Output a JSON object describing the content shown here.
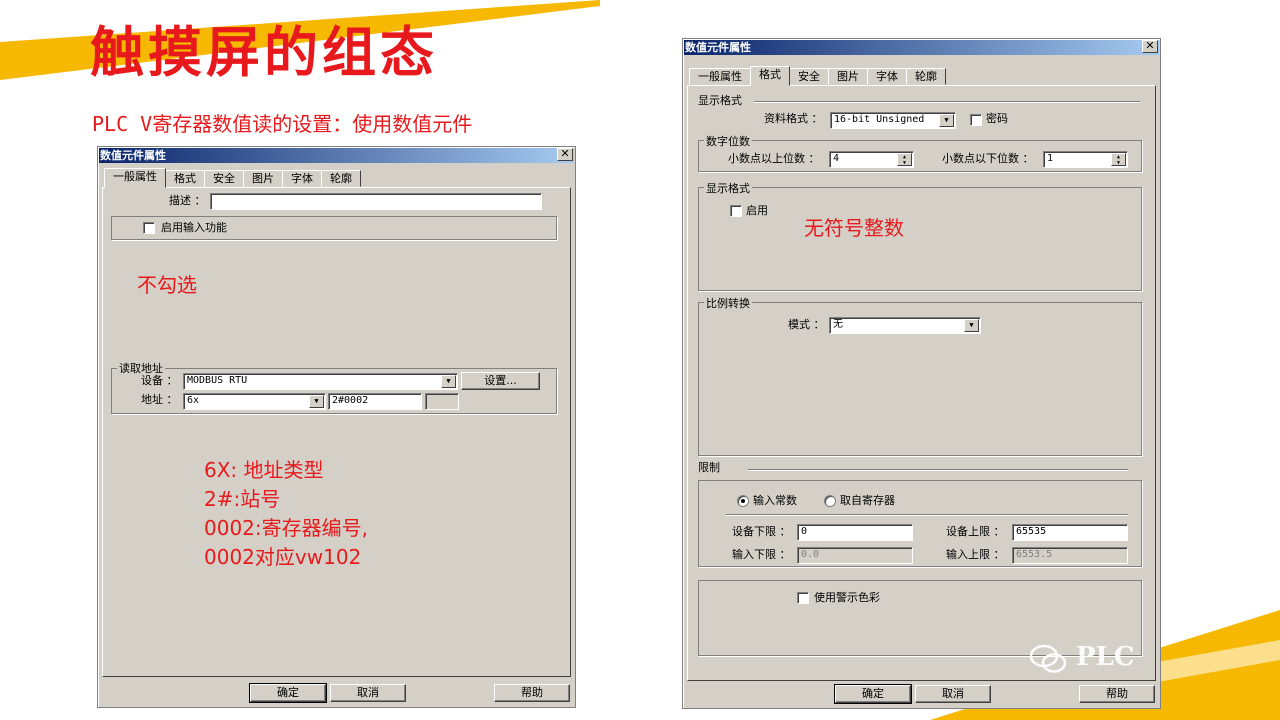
{
  "slide": {
    "title": "触摸屏的组态",
    "subtitle": "PLC  V寄存器数值读的设置：使用数值元件",
    "colors": {
      "accent_red": "#e8191c",
      "band_yellow": "#f6b800",
      "title_blue": "#0a246a"
    },
    "watermark": "PLC"
  },
  "left_dialog": {
    "title": "数值元件属性",
    "close": "✕",
    "tabs": [
      "一般属性",
      "格式",
      "安全",
      "图片",
      "字体",
      "轮廓"
    ],
    "active_tab": "一般属性",
    "desc_label": "描述 ：",
    "desc_value": "",
    "enable_input_label": "启用输入功能",
    "read_group_label": "读取地址",
    "device_label": "设备 ：",
    "device_value": "MODBUS RTU",
    "settings_button": "设置...",
    "address_label": "地址 ：",
    "address_type": "6x",
    "address_value": "2#0002",
    "ok_button": "确定",
    "cancel_button": "取消",
    "help_button": "帮助"
  },
  "left_annotations": {
    "unchecked": "不勾选",
    "lines": [
      "6X: 地址类型",
      "2#:站号",
      "0002:寄存器编号,",
      "0002对应vw102"
    ]
  },
  "right_dialog": {
    "title": "数值元件属性",
    "close": "✕",
    "tabs": [
      "一般属性",
      "格式",
      "安全",
      "图片",
      "字体",
      "轮廓"
    ],
    "active_tab": "格式",
    "display_format_section": "显示格式",
    "data_format_label": "资料格式 ：",
    "data_format_value": "16-bit Unsigned",
    "password_label": "密码",
    "digits_group": "数字位数",
    "int_digits_label": "小数点以上位数 ：",
    "int_digits_value": "4",
    "frac_digits_label": "小数点以下位数 ：",
    "frac_digits_value": "1",
    "display_format_group": "显示格式",
    "enable_label": "启用",
    "annotation": "无符号整数",
    "scale_group": "比例转换",
    "mode_label": "模式 ：",
    "mode_value": "无",
    "limit_section": "限制",
    "radio_const": "输入常数",
    "radio_register": "取自寄存器",
    "dev_low_label": "设备下限 ：",
    "dev_low_value": "0",
    "dev_high_label": "设备上限 ：",
    "dev_high_value": "65535",
    "in_low_label": "输入下限 ：",
    "in_low_value": "0.0",
    "in_high_label": "输入上限 ：",
    "in_high_value": "6553.5",
    "alarm_color_label": "使用警示色彩",
    "ok_button": "确定",
    "cancel_button": "取消",
    "help_button": "帮助"
  }
}
